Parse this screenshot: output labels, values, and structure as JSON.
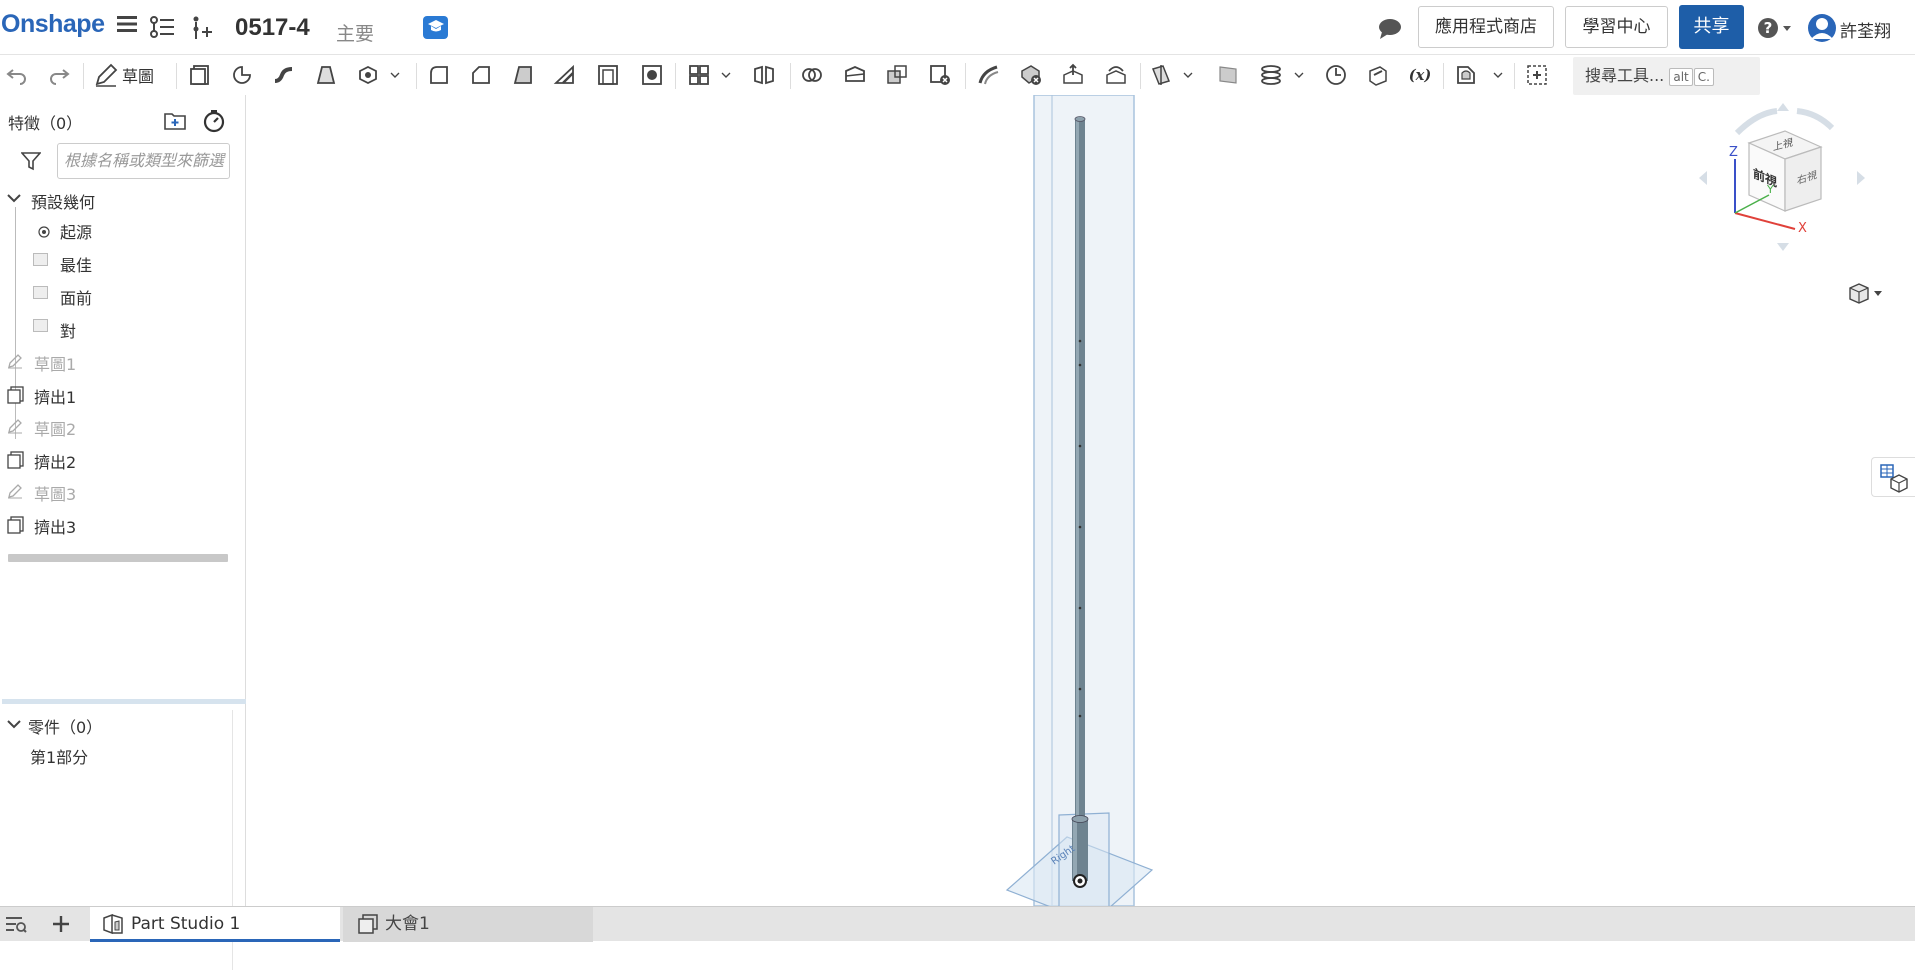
{
  "header": {
    "logo": "Onshape",
    "document_title": "0517-4",
    "branch": "主要",
    "app_store": "應用程式商店",
    "learning_center": "學習中心",
    "share": "共享",
    "user_name": "許荃翔"
  },
  "toolbar": {
    "sketch_label": "草圖",
    "search_tools": "搜尋工具...",
    "shortcut_alt": "alt",
    "shortcut_c": "C."
  },
  "feature_list": {
    "header": "特徵（0）",
    "filter_placeholder": "根據名稱或類型來篩選",
    "default_geometry": "預設幾何",
    "origin": "起源",
    "top_plane": "最佳",
    "front_plane": "面前",
    "right_plane": "對",
    "features": [
      {
        "label": "草圖1",
        "type": "sketch"
      },
      {
        "label": "擠出1",
        "type": "extrude"
      },
      {
        "label": "草圖2",
        "type": "sketch"
      },
      {
        "label": "擠出2",
        "type": "extrude"
      },
      {
        "label": "草圖3",
        "type": "sketch"
      },
      {
        "label": "擠出3",
        "type": "extrude"
      }
    ]
  },
  "parts": {
    "header": "零件（0）",
    "item": "第1部分"
  },
  "view_cube": {
    "top": "上視",
    "front": "前視",
    "right": "右視",
    "axis_x": "X",
    "axis_y": "Y",
    "axis_z": "Z"
  },
  "tabs": {
    "part_studio": "Part Studio 1",
    "assembly": "大會1"
  },
  "colors": {
    "brand": "#2a66b8",
    "share_button": "#1e5ea8",
    "part_body": "#6e8390"
  }
}
